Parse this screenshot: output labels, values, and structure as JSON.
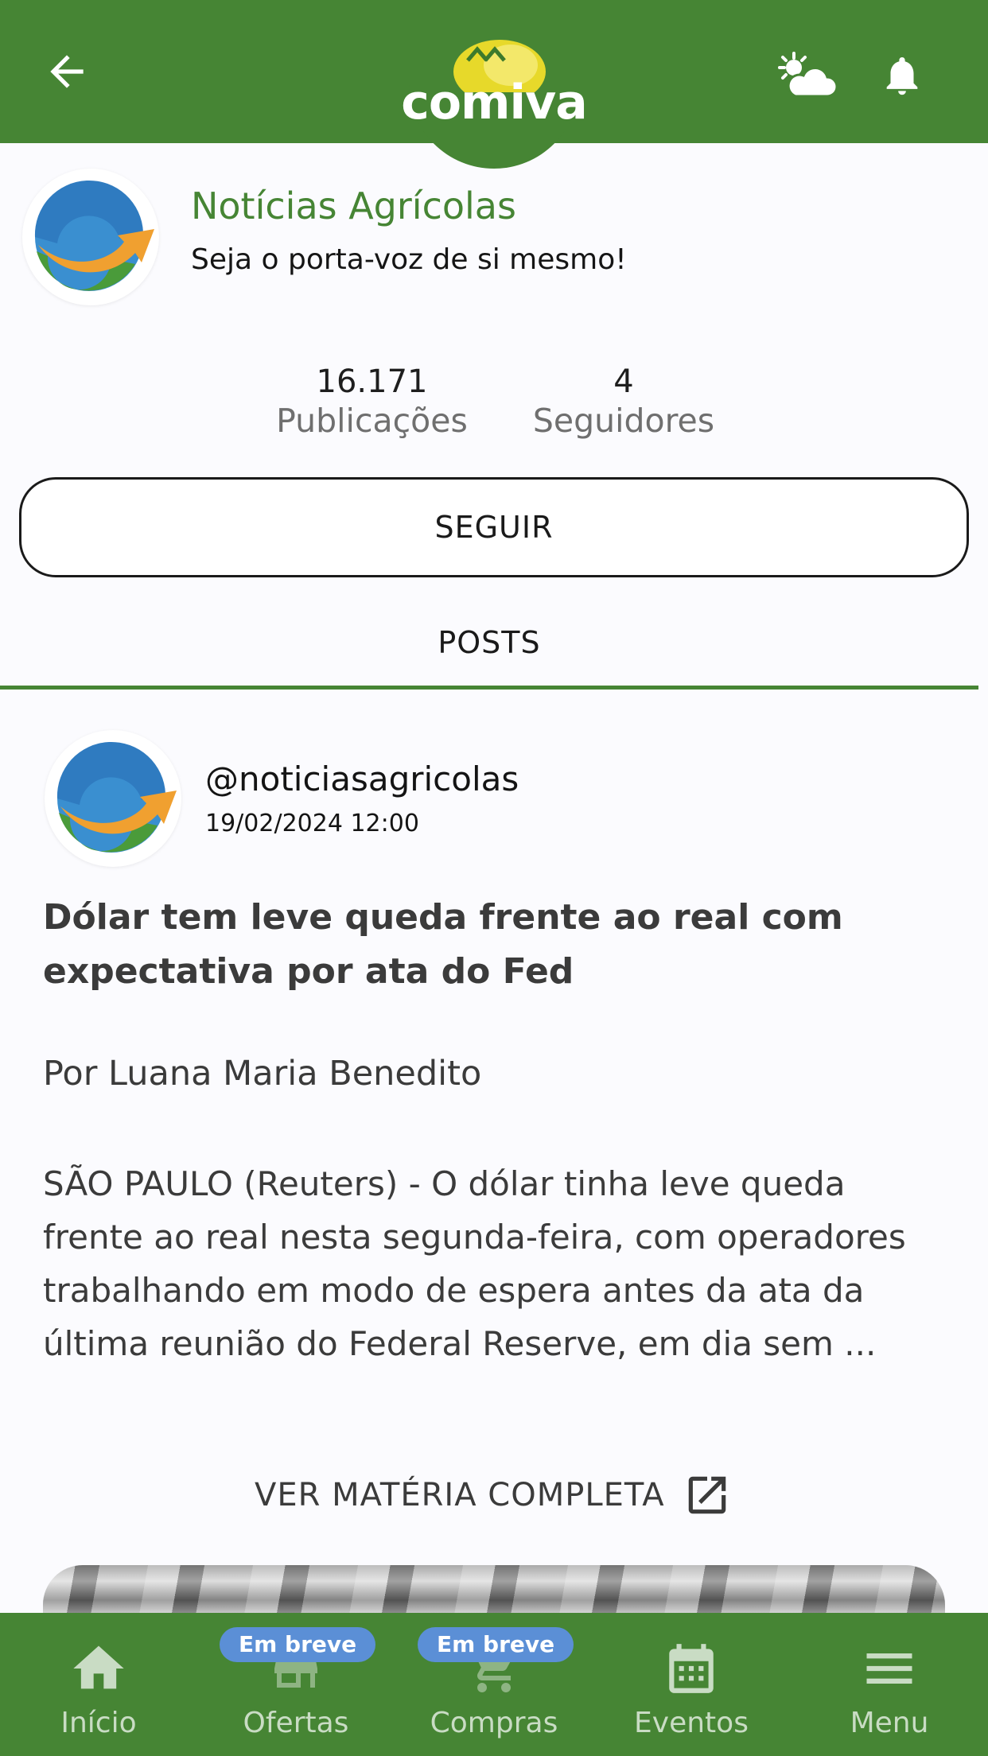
{
  "app": {
    "logo_text": "comiva",
    "colors": {
      "primary": "#468534",
      "badge": "#5b8fd6",
      "text": "#3b3b3b"
    },
    "icons": {
      "back": "arrow-left-icon",
      "weather": "partly-cloudy-icon",
      "notifications": "bell-icon"
    }
  },
  "profile": {
    "name": "Notícias Agrícolas",
    "tagline": "Seja o porta-voz de si mesmo!",
    "stats": {
      "publications": {
        "value": "16.171",
        "label": "Publicações"
      },
      "followers": {
        "value": "4",
        "label": "Seguidores"
      }
    },
    "follow_label": "SEGUIR"
  },
  "tabs": {
    "posts_label": "POSTS"
  },
  "post": {
    "handle": "@noticiasagricolas",
    "date": "19/02/2024 12:00",
    "title": "Dólar tem leve queda frente ao real com expectativa por ata do Fed",
    "author": "Por Luana Maria Benedito",
    "body": "SÃO PAULO (Reuters) - O dólar tinha leve queda frente ao real nesta segunda-feira, com operadores trabalhando em modo de espera antes da ata da última reunião do Federal Reserve, em dia sem ...",
    "see_full_label": "VER MATÉRIA COMPLETA",
    "see_full_icon": "open-in-new-icon"
  },
  "bottom_nav": {
    "items": [
      {
        "label": "Início",
        "icon": "home-icon"
      },
      {
        "label": "Ofertas",
        "icon": "store-icon",
        "badge": "Em breve"
      },
      {
        "label": "Compras",
        "icon": "cart-icon",
        "badge": "Em breve"
      },
      {
        "label": "Eventos",
        "icon": "calendar-icon"
      },
      {
        "label": "Menu",
        "icon": "menu-icon"
      }
    ]
  }
}
